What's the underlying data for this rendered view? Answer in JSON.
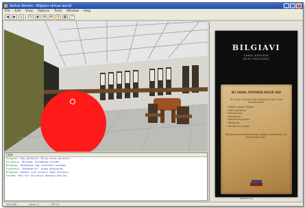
{
  "window": {
    "title": "Active Worlds - Bilgiavi virtual world"
  },
  "menu": [
    "File",
    "Edit",
    "View",
    "Options",
    "Tools",
    "Window",
    "Help"
  ],
  "toolbar_icons": [
    "back-icon",
    "forward-icon",
    "home-icon",
    "refresh-icon",
    "camera-icon",
    "zoom-icon",
    "settings-icon",
    "hand-icon",
    "map-icon",
    "help-icon"
  ],
  "info_panel": {
    "brand": "BILGIAVI",
    "tagline": "SANAL DÜNYADA",
    "subtag": "BİLGİ SAĞLIĞINIZ",
    "section_title": "BU SANAL DÜNYADA NELER VAR",
    "intro": "Bu sanal dünyada bilgi sağlığınızla ilgili neler bulabilirsiniz?",
    "items": [
      "Sağlıklı yaşam bilgileri",
      "Bilgi kaynakları",
      "Sohbet alanı",
      "Kütüphane",
      "Etkinlik duyuruları",
      "Rehberler",
      "Sorular ve yanıtlar"
    ],
    "note": "Bilgiavi sanal dünyasında bilgi sağlığınızı geliştirmek için birlikte öğrenelim.",
    "footer": "bilgiavi.org"
  },
  "log": {
    "header": "Chat",
    "lines": [
      {
        "k": "Bilgiavi:",
        "t": "Hoş geldiniz! Bilgi evine girdiniz."
      },
      {
        "k": "Kullanıcı:",
        "t": "Merhaba, kütüphane nerede?"
      },
      {
        "k": "Bilgiavi:",
        "t": "Kütüphane sağ taraftaki salonda."
      },
      {
        "k": "Ziyaretçi:",
        "t": "Teşekkürler, oraya gidiyorum."
      },
      {
        "k": "Bilgiavi:",
        "t": "Rehber için kırmızı topa tıklayın."
      },
      {
        "k": "Sistem:",
        "t": "Yeni bir kullanıcı dünyaya katıldı."
      }
    ]
  },
  "status": {
    "coords": "12N 34W",
    "users": "Users: 3",
    "fps": "FPS 24"
  },
  "colors": {
    "accent": "#1d4fae",
    "ball": "#ff1a1a",
    "poster_bg": "#0e0e0e"
  }
}
